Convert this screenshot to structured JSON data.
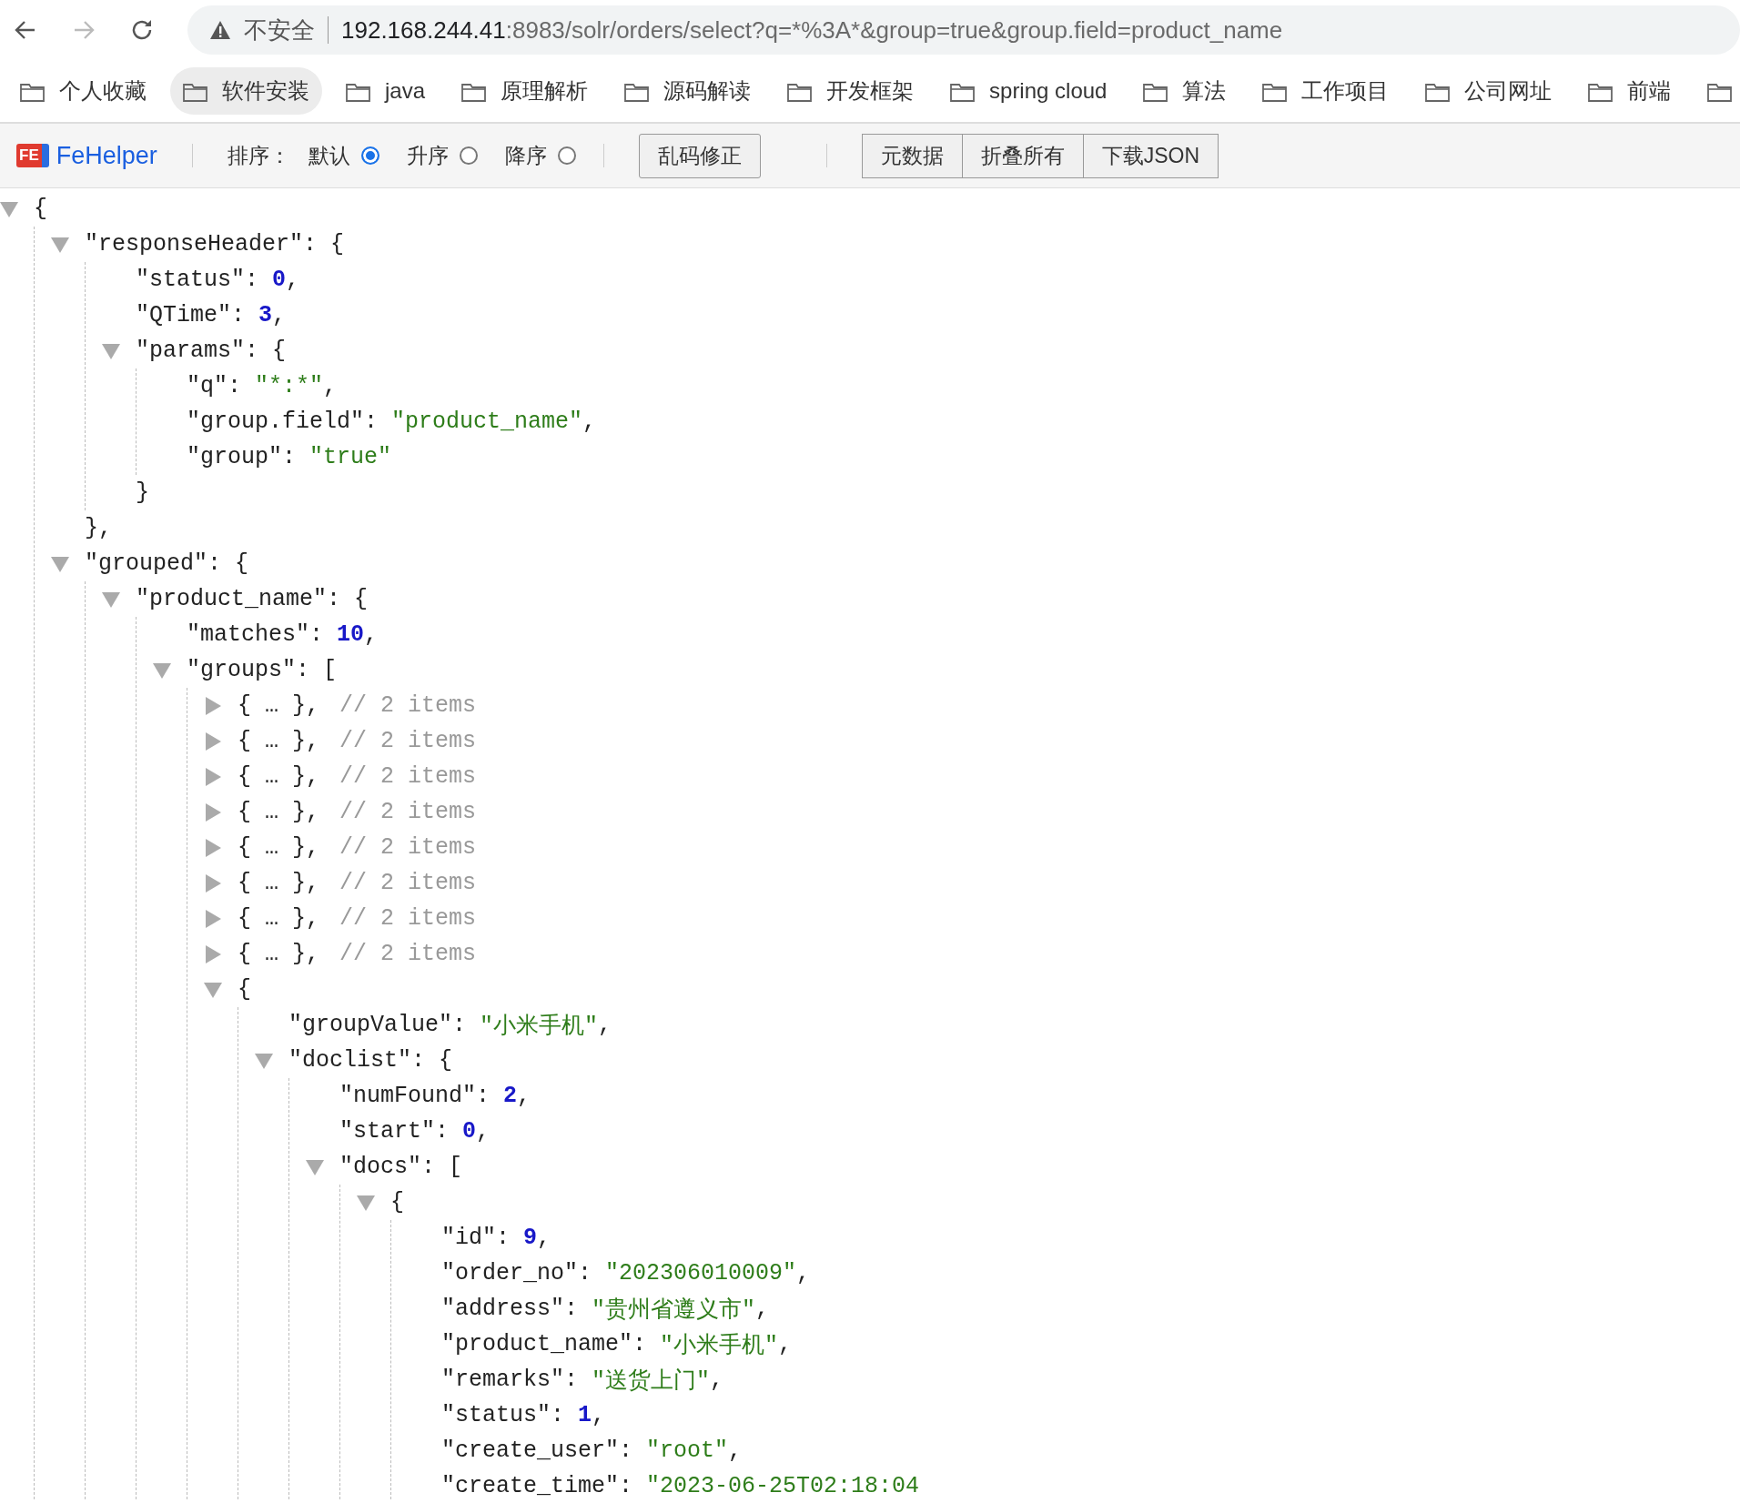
{
  "browser": {
    "back_disabled": false,
    "forward_disabled": true,
    "security": "不安全",
    "url_host": "192.168.244.41",
    "url_rest": ":8983/solr/orders/select?q=*%3A*&group=true&group.field=product_name"
  },
  "bookmarks": [
    {
      "label": "个人收藏",
      "selected": false
    },
    {
      "label": "软件安装",
      "selected": true
    },
    {
      "label": "java",
      "selected": false
    },
    {
      "label": "原理解析",
      "selected": false
    },
    {
      "label": "源码解读",
      "selected": false
    },
    {
      "label": "开发框架",
      "selected": false
    },
    {
      "label": "spring cloud",
      "selected": false
    },
    {
      "label": "算法",
      "selected": false
    },
    {
      "label": "工作项目",
      "selected": false
    },
    {
      "label": "公司网址",
      "selected": false
    },
    {
      "label": "前端",
      "selected": false
    },
    {
      "selected": false
    }
  ],
  "toolbar": {
    "logo_mark": "FE",
    "title": "FeHelper",
    "sort_label": "排序：",
    "sort_options": [
      {
        "label": "默认",
        "selected": true
      },
      {
        "label": "升序",
        "selected": false
      },
      {
        "label": "降序",
        "selected": false
      }
    ],
    "fix_button": "乱码修正",
    "buttons": [
      "元数据",
      "折叠所有",
      "下载JSON"
    ]
  },
  "tree": {
    "kind": "node",
    "expanded": true,
    "open": "{",
    "children": [
      {
        "kind": "node",
        "expanded": true,
        "key": "\"responseHeader\": ",
        "open": "{",
        "close": "},",
        "children": [
          {
            "kind": "number",
            "key": "\"status\": ",
            "value": "0",
            "tail": ","
          },
          {
            "kind": "number",
            "key": "\"QTime\": ",
            "value": "3",
            "tail": ","
          },
          {
            "kind": "node",
            "expanded": true,
            "key": "\"params\": ",
            "open": "{",
            "close": "}",
            "children": [
              {
                "kind": "string",
                "key": "\"q\": ",
                "value": "\"*:*\"",
                "tail": ","
              },
              {
                "kind": "string",
                "key": "\"group.field\": ",
                "value": "\"product_name\"",
                "tail": ","
              },
              {
                "kind": "string",
                "key": "\"group\": ",
                "value": "\"true\""
              }
            ]
          }
        ]
      },
      {
        "kind": "node",
        "expanded": true,
        "key": "\"grouped\": ",
        "open": "{",
        "children": [
          {
            "kind": "node",
            "expanded": true,
            "key": "\"product_name\": ",
            "open": "{",
            "children": [
              {
                "kind": "number",
                "key": "\"matches\": ",
                "value": "10",
                "tail": ","
              },
              {
                "kind": "node",
                "expanded": true,
                "key": "\"groups\": ",
                "open": "[",
                "children": [
                  {
                    "kind": "node",
                    "expanded": false,
                    "open": "{ … },",
                    "note": "// 2 items"
                  },
                  {
                    "kind": "node",
                    "expanded": false,
                    "open": "{ … },",
                    "note": "// 2 items"
                  },
                  {
                    "kind": "node",
                    "expanded": false,
                    "open": "{ … },",
                    "note": "// 2 items"
                  },
                  {
                    "kind": "node",
                    "expanded": false,
                    "open": "{ … },",
                    "note": "// 2 items"
                  },
                  {
                    "kind": "node",
                    "expanded": false,
                    "open": "{ … },",
                    "note": "// 2 items"
                  },
                  {
                    "kind": "node",
                    "expanded": false,
                    "open": "{ … },",
                    "note": "// 2 items"
                  },
                  {
                    "kind": "node",
                    "expanded": false,
                    "open": "{ … },",
                    "note": "// 2 items"
                  },
                  {
                    "kind": "node",
                    "expanded": false,
                    "open": "{ … },",
                    "note": "// 2 items"
                  },
                  {
                    "kind": "node",
                    "expanded": true,
                    "open": "{",
                    "children": [
                      {
                        "kind": "string",
                        "key": "\"groupValue\": ",
                        "value": "\"小米手机\"",
                        "tail": ","
                      },
                      {
                        "kind": "node",
                        "expanded": true,
                        "key": "\"doclist\": ",
                        "open": "{",
                        "children": [
                          {
                            "kind": "number",
                            "key": "\"numFound\": ",
                            "value": "2",
                            "tail": ","
                          },
                          {
                            "kind": "number",
                            "key": "\"start\": ",
                            "value": "0",
                            "tail": ","
                          },
                          {
                            "kind": "node",
                            "expanded": true,
                            "key": "\"docs\": ",
                            "open": "[",
                            "children": [
                              {
                                "kind": "node",
                                "expanded": true,
                                "open": "{",
                                "children": [
                                  {
                                    "kind": "number",
                                    "key": "\"id\": ",
                                    "value": "9",
                                    "tail": ","
                                  },
                                  {
                                    "kind": "string",
                                    "key": "\"order_no\": ",
                                    "value": "\"202306010009\"",
                                    "tail": ","
                                  },
                                  {
                                    "kind": "string",
                                    "key": "\"address\": ",
                                    "value": "\"贵州省遵义市\"",
                                    "tail": ","
                                  },
                                  {
                                    "kind": "string",
                                    "key": "\"product_name\": ",
                                    "value": "\"小米手机\"",
                                    "tail": ","
                                  },
                                  {
                                    "kind": "string",
                                    "key": "\"remarks\": ",
                                    "value": "\"送货上门\"",
                                    "tail": ","
                                  },
                                  {
                                    "kind": "number",
                                    "key": "\"status\": ",
                                    "value": "1",
                                    "tail": ","
                                  },
                                  {
                                    "kind": "string",
                                    "key": "\"create_user\": ",
                                    "value": "\"root\"",
                                    "tail": ","
                                  },
                                  {
                                    "kind": "string",
                                    "key": "\"create_time\": ",
                                    "value": "\"2023-06-25T02:18:04"
                                  }
                                ]
                              }
                            ]
                          }
                        ]
                      }
                    ]
                  }
                ]
              }
            ]
          }
        ]
      }
    ]
  }
}
